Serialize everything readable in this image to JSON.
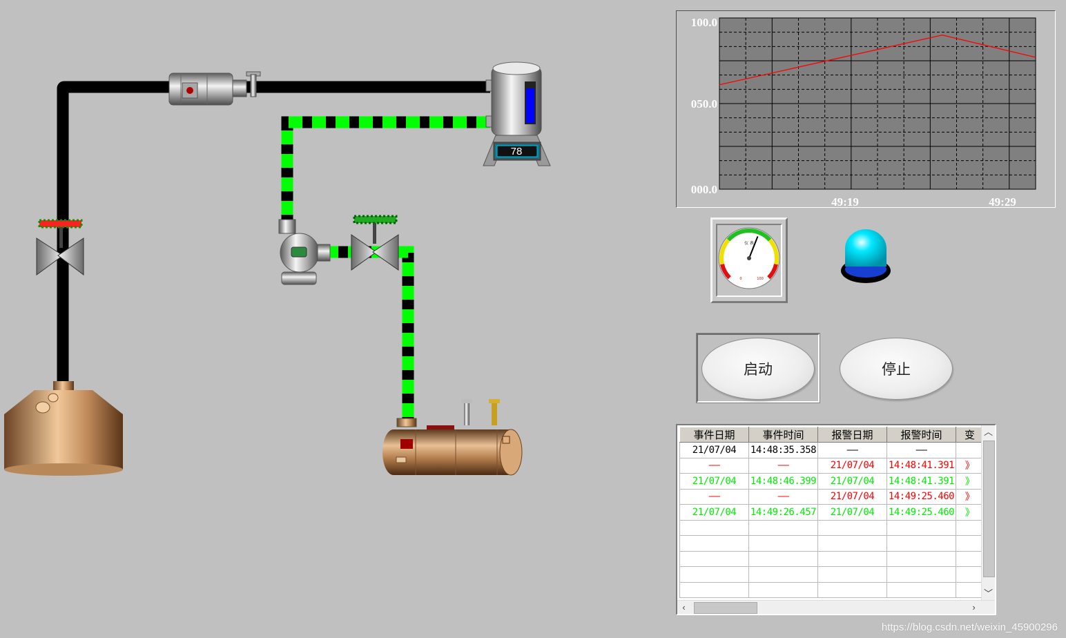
{
  "process": {
    "tank_level": "78",
    "colors": {
      "pipe_inactive": "#000000",
      "pipe_flow": "#00ff00",
      "background": "#c0c0c0"
    },
    "icons": [
      "valve-icon",
      "motor-icon",
      "pump-icon",
      "storage-tank-icon",
      "vessel-icon",
      "horizontal-tank-icon"
    ]
  },
  "chart_data": {
    "type": "line",
    "y_ticks": [
      "100.0",
      "050.0",
      "000.0"
    ],
    "x_ticks": [
      "49:19",
      "49:29"
    ],
    "ylim": [
      0,
      100
    ],
    "series": [
      {
        "color": "#ff0000",
        "values": [
          61,
          90,
          77
        ]
      }
    ],
    "grid": true,
    "plot_background": "#808080"
  },
  "gauge": {
    "value_fraction": 0.58,
    "min_label": "0",
    "max_label": "100",
    "caption": "仪 表"
  },
  "indicator_light": {
    "color": "#00e8ff",
    "state": "on"
  },
  "buttons": {
    "start_label": "启动",
    "stop_label": "停止"
  },
  "alarm_table": {
    "columns": [
      "事件日期",
      "事件时间",
      "报警日期",
      "报警时间",
      "变"
    ],
    "rows": [
      {
        "color": "#000000",
        "cells": [
          "21/07/04",
          "14:48:35.358",
          "——",
          "——",
          ""
        ]
      },
      {
        "color": "#ff0000",
        "cells": [
          "——",
          "——",
          "21/07/04",
          "14:48:41.391",
          "》"
        ]
      },
      {
        "color": "#00ee00",
        "cells": [
          "21/07/04",
          "14:48:46.399",
          "21/07/04",
          "14:48:41.391",
          "》"
        ]
      },
      {
        "color": "#ff0000",
        "cells": [
          "——",
          "——",
          "21/07/04",
          "14:49:25.460",
          "》"
        ]
      },
      {
        "color": "#00ee00",
        "cells": [
          "21/07/04",
          "14:49:26.457",
          "21/07/04",
          "14:49:25.460",
          "》"
        ]
      },
      {
        "color": "#000000",
        "cells": [
          "",
          "",
          "",
          "",
          ""
        ]
      },
      {
        "color": "#000000",
        "cells": [
          "",
          "",
          "",
          "",
          ""
        ]
      },
      {
        "color": "#000000",
        "cells": [
          "",
          "",
          "",
          "",
          ""
        ]
      },
      {
        "color": "#000000",
        "cells": [
          "",
          "",
          "",
          "",
          ""
        ]
      },
      {
        "color": "#000000",
        "cells": [
          "",
          "",
          "",
          "",
          ""
        ]
      }
    ]
  },
  "watermark": "https://blog.csdn.net/weixin_45900296"
}
